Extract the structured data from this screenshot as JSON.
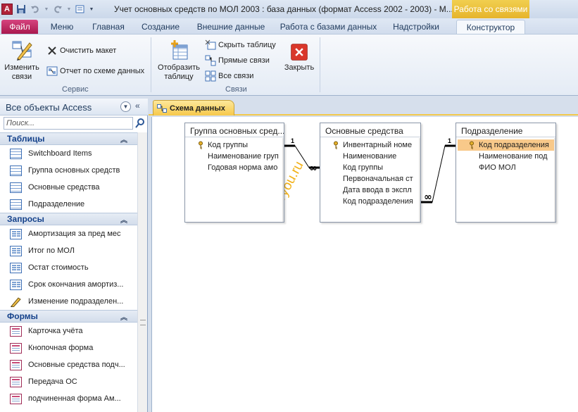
{
  "window": {
    "title": "Учет основных средств по МОЛ 2003 : база данных (формат Access 2002 - 2003)  -  M...",
    "context_title": "Работа со связями"
  },
  "tabs": [
    {
      "label": "Файл"
    },
    {
      "label": "Меню"
    },
    {
      "label": "Главная"
    },
    {
      "label": "Создание"
    },
    {
      "label": "Внешние данные"
    },
    {
      "label": "Работа с базами данных"
    },
    {
      "label": "Надстройки"
    },
    {
      "label": "Конструктор"
    }
  ],
  "ribbon": {
    "service_group": {
      "label": "Сервис",
      "edit_relations": "Изменить\nсвязи",
      "clear_layout": "Очистить макет",
      "relation_report": "Отчет по схеме данных"
    },
    "relations_group": {
      "label": "Связи",
      "show_table": "Отобразить\nтаблицу",
      "hide_table": "Скрыть таблицу",
      "direct_relations": "Прямые связи",
      "all_relations": "Все связи",
      "close": "Закрыть"
    }
  },
  "nav": {
    "title": "Все объекты Access",
    "search_placeholder": "Поиск...",
    "sections": {
      "tables": {
        "label": "Таблицы",
        "items": [
          "Switchboard Items",
          "Группа основных средств",
          "Основные средства",
          "Подразделение"
        ]
      },
      "queries": {
        "label": "Запросы",
        "items": [
          "Амортизация за пред мес",
          "Итог по МОЛ",
          "Остат стоимость",
          "Срок окончания амортиз...",
          "Изменение подразделен..."
        ]
      },
      "forms": {
        "label": "Формы",
        "items": [
          "Карточка учёта",
          "Кнопочная форма",
          "Основные средства подч...",
          "Передача ОС",
          "подчиненная форма Ам..."
        ]
      }
    }
  },
  "document": {
    "tab_label": "Схема данных",
    "watermark": "dbforyou.ru",
    "tables": {
      "group": {
        "title": "Группа основных сред...",
        "fields": [
          "Код группы",
          "Наименование груп",
          "Годовая норма амо"
        ]
      },
      "assets": {
        "title": "Основные средства",
        "fields": [
          "Инвентарный номе",
          "Наименование",
          "Код группы",
          "Первоначальная ст",
          "Дата ввода в экспл",
          "Код подразделения"
        ]
      },
      "division": {
        "title": "Подразделение",
        "fields": [
          "Код подразделения",
          "Наименование под",
          "ФИО МОЛ"
        ]
      }
    },
    "relations": [
      {
        "one_label": "1",
        "many_label": "∞"
      },
      {
        "one_label": "1",
        "many_label": "∞"
      }
    ]
  },
  "colors": {
    "accent": "#f6c84b",
    "file_tab": "#c42b62",
    "selected_field": "#f8c98a",
    "watermark": "#f0a800"
  }
}
